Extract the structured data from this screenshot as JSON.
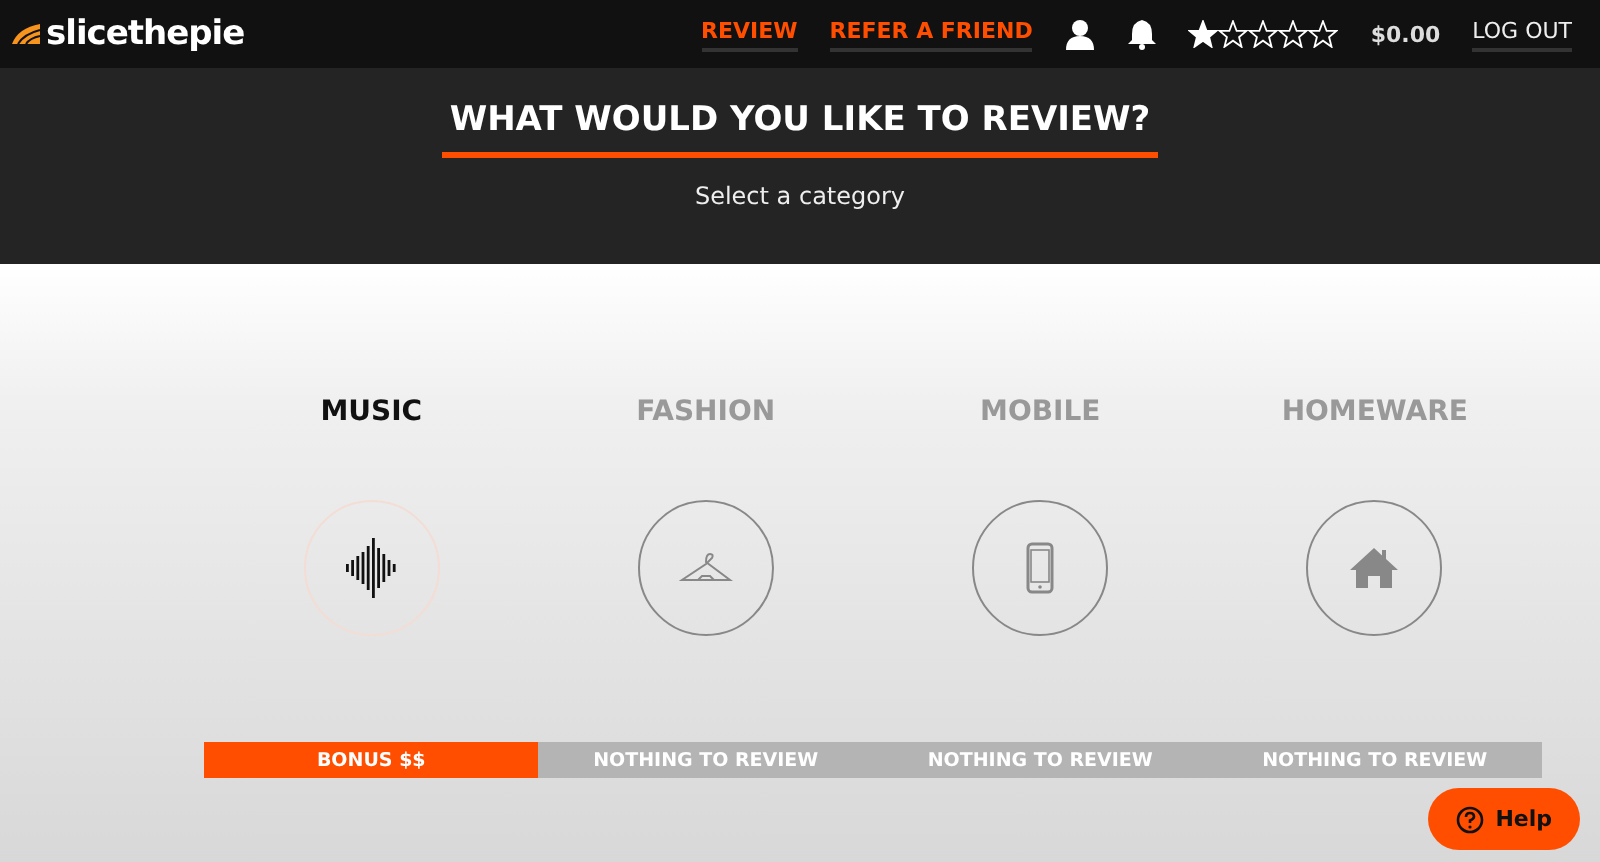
{
  "header": {
    "logo": "slicethepie",
    "nav": [
      {
        "label": "REVIEW",
        "kind": "accent"
      },
      {
        "label": "REFER A FRIEND",
        "kind": "accent"
      }
    ],
    "stars": 1,
    "balance": "$0.00",
    "logout": "LOG OUT"
  },
  "hero": {
    "title": "WHAT WOULD YOU LIKE TO REVIEW?",
    "subtitle": "Select a category"
  },
  "categories": [
    {
      "label": "MUSIC",
      "selected": true,
      "status": "BONUS $$",
      "kind": "bonus"
    },
    {
      "label": "FASHION",
      "selected": false,
      "status": "NOTHING TO REVIEW",
      "kind": "empty"
    },
    {
      "label": "MOBILE",
      "selected": false,
      "status": "NOTHING TO REVIEW",
      "kind": "empty"
    },
    {
      "label": "HOMEWARE",
      "selected": false,
      "status": "NOTHING TO REVIEW",
      "kind": "empty"
    }
  ],
  "help": {
    "label": "Help"
  }
}
